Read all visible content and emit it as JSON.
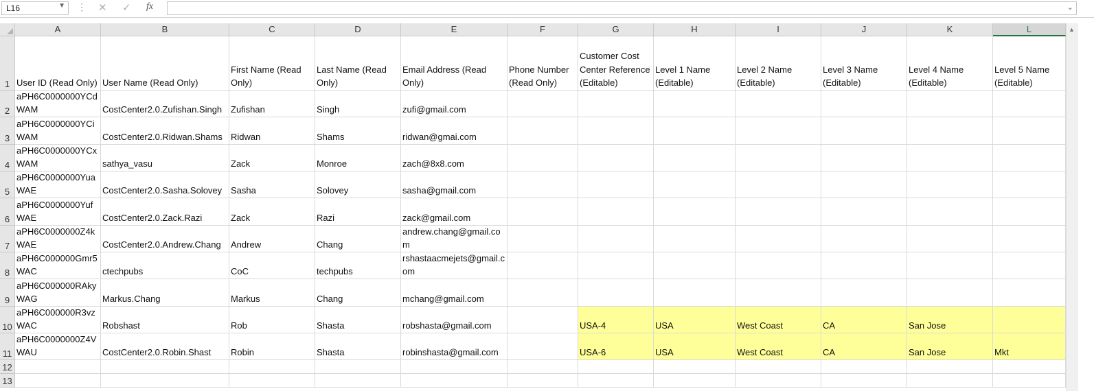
{
  "formula_bar": {
    "name_box": "L16",
    "cancel_icon": "✕",
    "enter_icon": "✓",
    "fx_label": "fx",
    "formula_value": ""
  },
  "columns": [
    "A",
    "B",
    "C",
    "D",
    "E",
    "F",
    "G",
    "H",
    "I",
    "J",
    "K",
    "L"
  ],
  "selected_column": "L",
  "row_numbers": [
    "1",
    "2",
    "3",
    "4",
    "5",
    "6",
    "7",
    "8",
    "9",
    "10",
    "11",
    "12",
    "13"
  ],
  "rows": [
    [
      "User ID (Read Only)",
      "User Name (Read Only)",
      "First Name (Read Only)",
      "Last Name (Read Only)",
      "Email Address (Read Only)",
      "Phone Number (Read Only)",
      "Customer Cost Center Reference (Editable)",
      "Level 1 Name (Editable)",
      "Level 2 Name (Editable)",
      "Level 3 Name (Editable)",
      "Level 4 Name (Editable)",
      "Level 5 Name (Editable)"
    ],
    [
      "aPH6C0000000YCdWAM",
      "CostCenter2.0.Zufishan.Singh",
      "Zufishan",
      "Singh",
      "zufi@gmail.com",
      "",
      "",
      "",
      "",
      "",
      "",
      ""
    ],
    [
      "aPH6C0000000YCiWAM",
      "CostCenter2.0.Ridwan.Shams",
      "Ridwan",
      "Shams",
      "ridwan@gmai.com",
      "",
      "",
      "",
      "",
      "",
      "",
      ""
    ],
    [
      "aPH6C0000000YCxWAM",
      "sathya_vasu",
      "Zack",
      "Monroe",
      "zach@8x8.com",
      "",
      "",
      "",
      "",
      "",
      "",
      ""
    ],
    [
      "aPH6C0000000YuaWAE",
      "CostCenter2.0.Sasha.Solovey",
      "Sasha",
      "Solovey",
      "sasha@gmail.com",
      "",
      "",
      "",
      "",
      "",
      "",
      ""
    ],
    [
      "aPH6C0000000YufWAE",
      "CostCenter2.0.Zack.Razi",
      "Zack",
      "Razi",
      "zack@gmail.com",
      "",
      "",
      "",
      "",
      "",
      "",
      ""
    ],
    [
      "aPH6C0000000Z4kWAE",
      "CostCenter2.0.Andrew.Chang",
      "Andrew",
      "Chang",
      "andrew.chang@gmail.com",
      "",
      "",
      "",
      "",
      "",
      "",
      ""
    ],
    [
      "aPH6C000000Gmr5WAC",
      "ctechpubs",
      "CoC",
      "techpubs",
      "rshastaacmejets@gmail.com",
      "",
      "",
      "",
      "",
      "",
      "",
      ""
    ],
    [
      "aPH6C000000RAkyWAG",
      "Markus.Chang",
      "Markus",
      "Chang",
      "mchang@gmail.com",
      "",
      "",
      "",
      "",
      "",
      "",
      ""
    ],
    [
      "aPH6C000000R3vzWAC",
      "Robshast",
      "Rob",
      "Shasta",
      "robshasta@gmail.com",
      "",
      "USA-4",
      "USA",
      "West Coast",
      "CA",
      "San Jose",
      ""
    ],
    [
      "aPH6C0000000Z4VWAU",
      "CostCenter2.0.Robin.Shast",
      "Robin",
      "Shasta",
      "robinshasta@gmail.com",
      "",
      "USA-6",
      "USA",
      "West Coast",
      "CA",
      "San Jose",
      "Mkt"
    ],
    [
      "",
      "",
      "",
      "",
      "",
      "",
      "",
      "",
      "",
      "",
      "",
      ""
    ],
    [
      "",
      "",
      "",
      "",
      "",
      "",
      "",
      "",
      "",
      "",
      "",
      ""
    ]
  ],
  "colors": {
    "highlight": "#ffff99",
    "selected_header_accent": "#217346"
  }
}
